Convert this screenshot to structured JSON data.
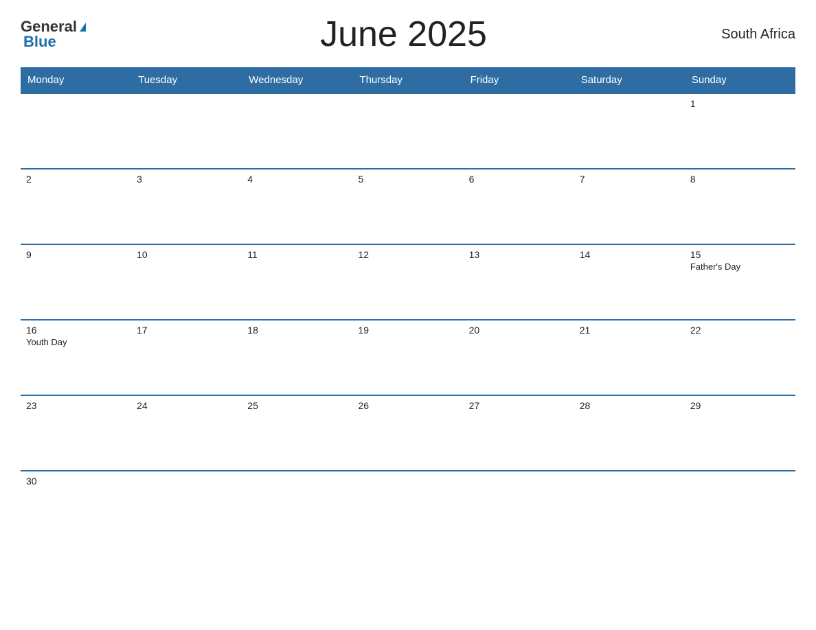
{
  "header": {
    "title": "June 2025",
    "country": "South Africa",
    "logo_general": "General",
    "logo_blue": "Blue"
  },
  "weekdays": [
    "Monday",
    "Tuesday",
    "Wednesday",
    "Thursday",
    "Friday",
    "Saturday",
    "Sunday"
  ],
  "rows": [
    {
      "shaded": true,
      "cells": [
        {
          "day": "",
          "event": ""
        },
        {
          "day": "",
          "event": ""
        },
        {
          "day": "",
          "event": ""
        },
        {
          "day": "",
          "event": ""
        },
        {
          "day": "",
          "event": ""
        },
        {
          "day": "",
          "event": ""
        },
        {
          "day": "1",
          "event": ""
        }
      ]
    },
    {
      "shaded": false,
      "cells": [
        {
          "day": "2",
          "event": ""
        },
        {
          "day": "3",
          "event": ""
        },
        {
          "day": "4",
          "event": ""
        },
        {
          "day": "5",
          "event": ""
        },
        {
          "day": "6",
          "event": ""
        },
        {
          "day": "7",
          "event": ""
        },
        {
          "day": "8",
          "event": ""
        }
      ]
    },
    {
      "shaded": true,
      "cells": [
        {
          "day": "9",
          "event": ""
        },
        {
          "day": "10",
          "event": ""
        },
        {
          "day": "11",
          "event": ""
        },
        {
          "day": "12",
          "event": ""
        },
        {
          "day": "13",
          "event": ""
        },
        {
          "day": "14",
          "event": ""
        },
        {
          "day": "15",
          "event": "Father's Day"
        }
      ]
    },
    {
      "shaded": false,
      "cells": [
        {
          "day": "16",
          "event": "Youth Day"
        },
        {
          "day": "17",
          "event": ""
        },
        {
          "day": "18",
          "event": ""
        },
        {
          "day": "19",
          "event": ""
        },
        {
          "day": "20",
          "event": ""
        },
        {
          "day": "21",
          "event": ""
        },
        {
          "day": "22",
          "event": ""
        }
      ]
    },
    {
      "shaded": true,
      "cells": [
        {
          "day": "23",
          "event": ""
        },
        {
          "day": "24",
          "event": ""
        },
        {
          "day": "25",
          "event": ""
        },
        {
          "day": "26",
          "event": ""
        },
        {
          "day": "27",
          "event": ""
        },
        {
          "day": "28",
          "event": ""
        },
        {
          "day": "29",
          "event": ""
        }
      ]
    },
    {
      "shaded": false,
      "last": true,
      "cells": [
        {
          "day": "30",
          "event": ""
        },
        {
          "day": "",
          "event": ""
        },
        {
          "day": "",
          "event": ""
        },
        {
          "day": "",
          "event": ""
        },
        {
          "day": "",
          "event": ""
        },
        {
          "day": "",
          "event": ""
        },
        {
          "day": "",
          "event": ""
        }
      ]
    }
  ]
}
